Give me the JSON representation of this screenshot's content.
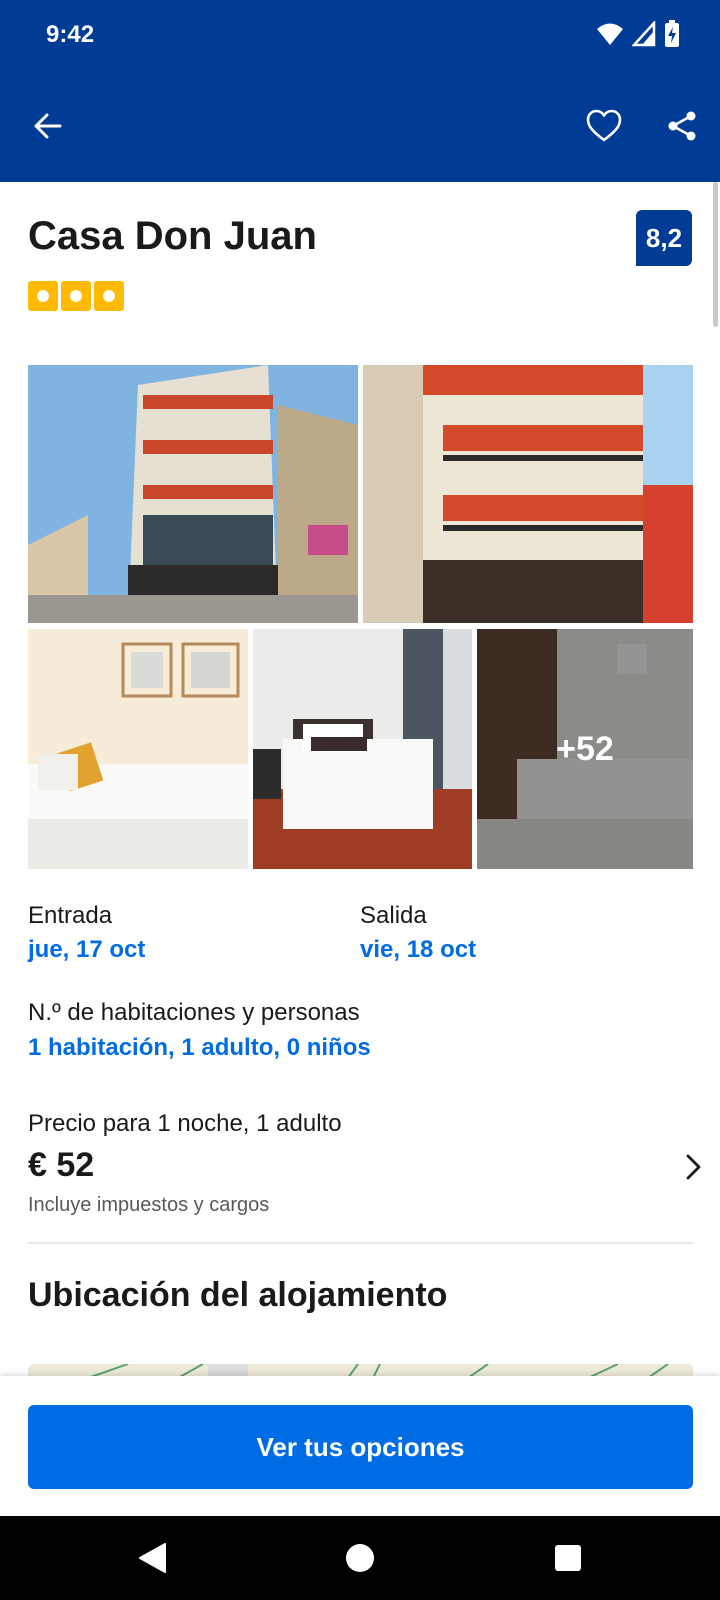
{
  "status_bar": {
    "time": "9:42"
  },
  "toolbar": {
    "back_icon": "arrow-left-icon",
    "favorite_icon": "heart-outline-icon",
    "share_icon": "share-icon"
  },
  "hotel": {
    "name": "Casa Don Juan",
    "rating_score": "8,2",
    "stars": 3
  },
  "gallery": {
    "more_count": "+52"
  },
  "dates": {
    "checkin_label": "Entrada",
    "checkin_value": "jue, 17 oct",
    "checkout_label": "Salida",
    "checkout_value": "vie, 18 oct"
  },
  "occupancy": {
    "label": "N.º de habitaciones y personas",
    "value": "1 habitación, 1 adulto, 0 niños"
  },
  "price": {
    "label": "Precio para 1 noche, 1 adulto",
    "amount": "€ 52",
    "note": "Incluye impuestos y cargos"
  },
  "location": {
    "title": "Ubicación del alojamiento"
  },
  "cta": {
    "label": "Ver tus opciones"
  },
  "colors": {
    "brand": "#003b95",
    "accent": "#006ce4",
    "star": "#febb02"
  }
}
